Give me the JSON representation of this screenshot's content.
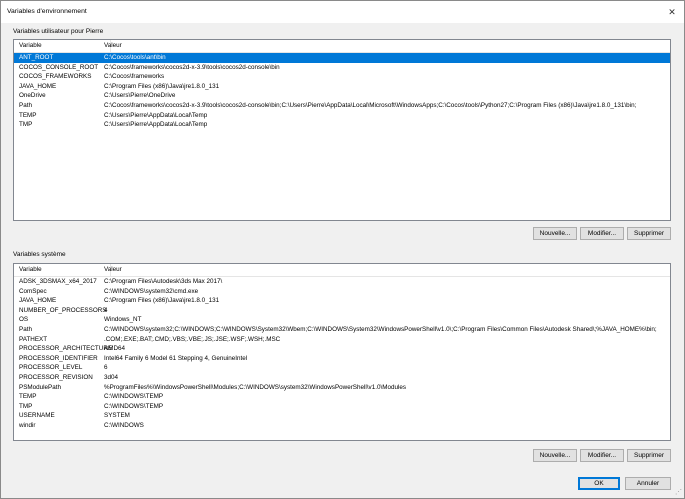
{
  "window": {
    "title": "Variables d'environnement",
    "close_icon": "close-icon",
    "close_glyph": "✕"
  },
  "user_vars": {
    "group_label": "Variables utilisateur pour Pierre",
    "columns": [
      "Variable",
      "Valeur"
    ],
    "rows": [
      {
        "name": "ANT_ROOT",
        "value": "C:\\Cocos\\tools\\ant\\bin",
        "selected": true
      },
      {
        "name": "COCOS_CONSOLE_ROOT",
        "value": "C:\\Cocos\\frameworks\\cocos2d-x-3.9\\tools\\cocos2d-console\\bin"
      },
      {
        "name": "COCOS_FRAMEWORKS",
        "value": "C:\\Cocos\\frameworks"
      },
      {
        "name": "JAVA_HOME",
        "value": "C:\\Program Files (x86)\\Java\\jre1.8.0_131"
      },
      {
        "name": "OneDrive",
        "value": "C:\\Users\\Pierre\\OneDrive"
      },
      {
        "name": "Path",
        "value": "C:\\Cocos\\frameworks\\cocos2d-x-3.9\\tools\\cocos2d-console\\bin;C:\\Users\\Pierre\\AppData\\Local\\Microsoft\\WindowsApps;C:\\Cocos\\tools\\Python27;C:\\Program Files (x86)\\Java\\jre1.8.0_131\\bin;"
      },
      {
        "name": "TEMP",
        "value": "C:\\Users\\Pierre\\AppData\\Local\\Temp"
      },
      {
        "name": "TMP",
        "value": "C:\\Users\\Pierre\\AppData\\Local\\Temp"
      }
    ],
    "buttons": {
      "new": "Nouvelle...",
      "edit": "Modifier...",
      "delete": "Supprimer"
    }
  },
  "system_vars": {
    "group_label": "Variables système",
    "columns": [
      "Variable",
      "Valeur"
    ],
    "rows": [
      {
        "name": "ADSK_3DSMAX_x64_2017",
        "value": "C:\\Program Files\\Autodesk\\3ds Max 2017\\"
      },
      {
        "name": "ComSpec",
        "value": "C:\\WINDOWS\\system32\\cmd.exe"
      },
      {
        "name": "JAVA_HOME",
        "value": "C:\\Program Files (x86)\\Java\\jre1.8.0_131"
      },
      {
        "name": "NUMBER_OF_PROCESSORS",
        "value": "4"
      },
      {
        "name": "OS",
        "value": "Windows_NT"
      },
      {
        "name": "Path",
        "value": "C:\\WINDOWS\\system32;C:\\WINDOWS;C:\\WINDOWS\\System32\\Wbem;C:\\WINDOWS\\System32\\WindowsPowerShell\\v1.0\\;C:\\Program Files\\Common Files\\Autodesk Shared\\;%JAVA_HOME%\\bin;"
      },
      {
        "name": "PATHEXT",
        "value": ".COM;.EXE;.BAT;.CMD;.VBS;.VBE;.JS;.JSE;.WSF;.WSH;.MSC"
      },
      {
        "name": "PROCESSOR_ARCHITECTURE",
        "value": "AMD64"
      },
      {
        "name": "PROCESSOR_IDENTIFIER",
        "value": "Intel64 Family 6 Model 61 Stepping 4, GenuineIntel"
      },
      {
        "name": "PROCESSOR_LEVEL",
        "value": "6"
      },
      {
        "name": "PROCESSOR_REVISION",
        "value": "3d04"
      },
      {
        "name": "PSModulePath",
        "value": "%ProgramFiles%\\WindowsPowerShell\\Modules;C:\\WINDOWS\\system32\\WindowsPowerShell\\v1.0\\Modules"
      },
      {
        "name": "TEMP",
        "value": "C:\\WINDOWS\\TEMP"
      },
      {
        "name": "TMP",
        "value": "C:\\WINDOWS\\TEMP"
      },
      {
        "name": "USERNAME",
        "value": "SYSTEM"
      },
      {
        "name": "windir",
        "value": "C:\\WINDOWS"
      }
    ],
    "buttons": {
      "new": "Nouvelle...",
      "edit": "Modifier...",
      "delete": "Supprimer"
    }
  },
  "footer": {
    "ok": "OK",
    "cancel": "Annuler"
  },
  "colors": {
    "selection": "#0078d7",
    "window_bg": "#f0f0f0",
    "list_bg": "#ffffff"
  }
}
